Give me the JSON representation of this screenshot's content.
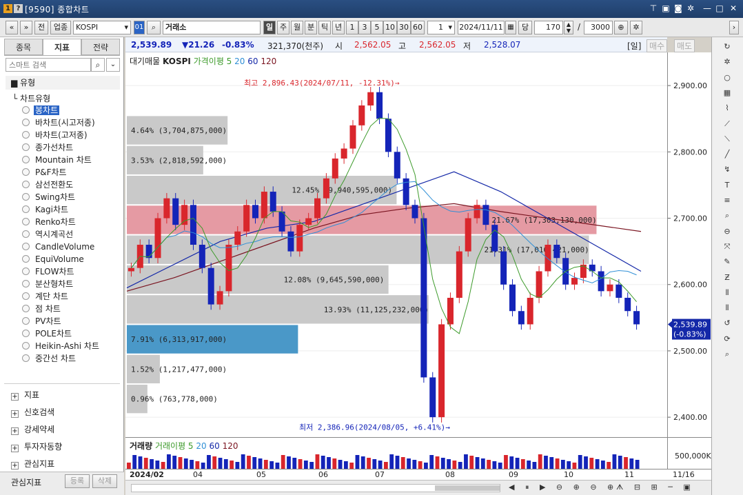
{
  "window": {
    "badge1": "1",
    "badge2": "?",
    "title": "[9590] 종합차트"
  },
  "toolbar": {
    "nav_prev": "«",
    "nav_down": "»",
    "jeon": "전",
    "sector": "업종",
    "symbol": "KOSPI",
    "code_badge": "01",
    "exchange": "거래소",
    "periods": [
      "일",
      "주",
      "월",
      "분",
      "틱",
      "년"
    ],
    "minute_opts": [
      "1",
      "3",
      "5",
      "10",
      "30",
      "60"
    ],
    "interval_value": "1",
    "date": "2024/11/11",
    "dang": "당",
    "count": "170",
    "slash": "/",
    "total": "3000"
  },
  "left": {
    "tabs": [
      "종목",
      "지표",
      "전략"
    ],
    "search_placeholder": "스마트 검색",
    "section": "유형",
    "group": "차트유형",
    "items": [
      "봉차트",
      "바차트(시고저종)",
      "바차트(고저종)",
      "종가선차트",
      "Mountain 차트",
      "P&F차트",
      "삼선전환도",
      "Swing차트",
      "Kagi차트",
      "Renko차트",
      "역시계곡선",
      "CandleVolume",
      "EquiVolume",
      "FLOW차트",
      "분산형차트",
      "계단 차트",
      "점 차트",
      "PV차트",
      "POLE차트",
      "Heikin-Ashi 차트",
      "중간선 차트"
    ],
    "groups": [
      "지표",
      "신호검색",
      "강세약세",
      "투자자동향",
      "관심지표"
    ],
    "fav": "관심지표",
    "reg": "등록",
    "del": "삭제"
  },
  "quote": {
    "last": "2,539.89",
    "change": "▼21.26",
    "pct": "-0.83%",
    "volume": "321,370(천주)",
    "o_label": "시",
    "o": "2,562.05",
    "h_label": "고",
    "h": "2,562.05",
    "l_label": "저",
    "l": "2,528.07",
    "period": "[일]",
    "buy": "매수",
    "sell": "매도"
  },
  "legend": {
    "a": "대기매물",
    "b": "KOSPI",
    "c": "가격이평 5",
    "d": "20",
    "e": "60",
    "f": "120"
  },
  "vlegend": {
    "a": "거래량",
    "b": "거래이평 5",
    "c": "20",
    "d": "60",
    "e": "120"
  },
  "colors": {
    "up": "#d9262c",
    "down": "#1424b8",
    "ma5": "#3c9a2a",
    "ma20": "#2f8fd6",
    "ma60": "#1428a8",
    "ma120": "#7a1420",
    "band": "#c9c9c9",
    "bandHi": "#e59aa3",
    "bandCur": "#4a98c8"
  },
  "chart_data": {
    "type": "candlestick",
    "y_ticks": [
      2400,
      2500,
      2600,
      2700,
      2800,
      2900
    ],
    "ylim": [
      2370,
      2950
    ],
    "y_tick_labels": [
      "2,400.00",
      "2,500.00",
      "2,600.00",
      "2,700.00",
      "2,800.00",
      "2,900.00"
    ],
    "x_ticks": [
      "2024/02",
      "04",
      "05",
      "06",
      "07",
      "08",
      "09",
      "10",
      "11",
      "11/16"
    ],
    "annotations": {
      "high": "최고 2,896.43(2024/07/11, -12.31%)→",
      "low": "최저 2,386.96(2024/08/05, +6.41%)→"
    },
    "price_tag": {
      "value": "2,539.89",
      "pct": "(-0.83%)"
    },
    "vol_tick": "500,000K",
    "volume_profile": [
      {
        "from": 2855,
        "to": 2810,
        "pct": "4.64%",
        "vol": "(3,704,875,000)",
        "w": 0.186
      },
      {
        "from": 2810,
        "to": 2765,
        "pct": "3.53%",
        "vol": "(2,818,592,000)",
        "w": 0.141
      },
      {
        "from": 2765,
        "to": 2720,
        "pct": "12.45%",
        "vol": "(9,940,595,000)",
        "w": 0.498
      },
      {
        "from": 2720,
        "to": 2675,
        "pct": "21.67%",
        "vol": "(17,303,130,000)",
        "w": 0.867,
        "hi": true
      },
      {
        "from": 2675,
        "to": 2630,
        "pct": "21.31%",
        "vol": "(17,016,421,000)",
        "w": 0.853
      },
      {
        "from": 2630,
        "to": 2585,
        "pct": "12.08%",
        "vol": "(9,645,590,000)",
        "w": 0.483
      },
      {
        "from": 2585,
        "to": 2540,
        "pct": "13.93%",
        "vol": "(11,125,232,000)",
        "w": 0.557
      },
      {
        "from": 2540,
        "to": 2495,
        "pct": "7.91%",
        "vol": "(6,313,917,000)",
        "w": 0.316,
        "cur": true
      },
      {
        "from": 2495,
        "to": 2450,
        "pct": "1.52%",
        "vol": "(1,217,477,000)",
        "w": 0.061
      },
      {
        "from": 2450,
        "to": 2405,
        "pct": "0.96%",
        "vol": "(763,778,000)",
        "w": 0.038
      }
    ],
    "ma120": [
      2590,
      2610,
      2635,
      2660,
      2685,
      2705,
      2715,
      2722,
      2710,
      2700,
      2690,
      2680
    ],
    "ma60": [
      2595,
      2630,
      2665,
      2685,
      2695,
      2720,
      2745,
      2770,
      2740,
      2700,
      2660,
      2620
    ],
    "closes": [
      2625,
      2660,
      2640,
      2700,
      2730,
      2690,
      2720,
      2660,
      2625,
      2570,
      2590,
      2660,
      2680,
      2720,
      2700,
      2740,
      2710,
      2680,
      2650,
      2690,
      2700,
      2730,
      2760,
      2790,
      2805,
      2840,
      2870,
      2890,
      2850,
      2800,
      2760,
      2720,
      2700,
      2460,
      2400,
      2540,
      2580,
      2650,
      2700,
      2720,
      2690,
      2650,
      2600,
      2560,
      2540,
      2580,
      2620,
      2660,
      2640,
      2600,
      2610,
      2630,
      2620,
      2590,
      2600,
      2580,
      2560,
      2540
    ]
  }
}
